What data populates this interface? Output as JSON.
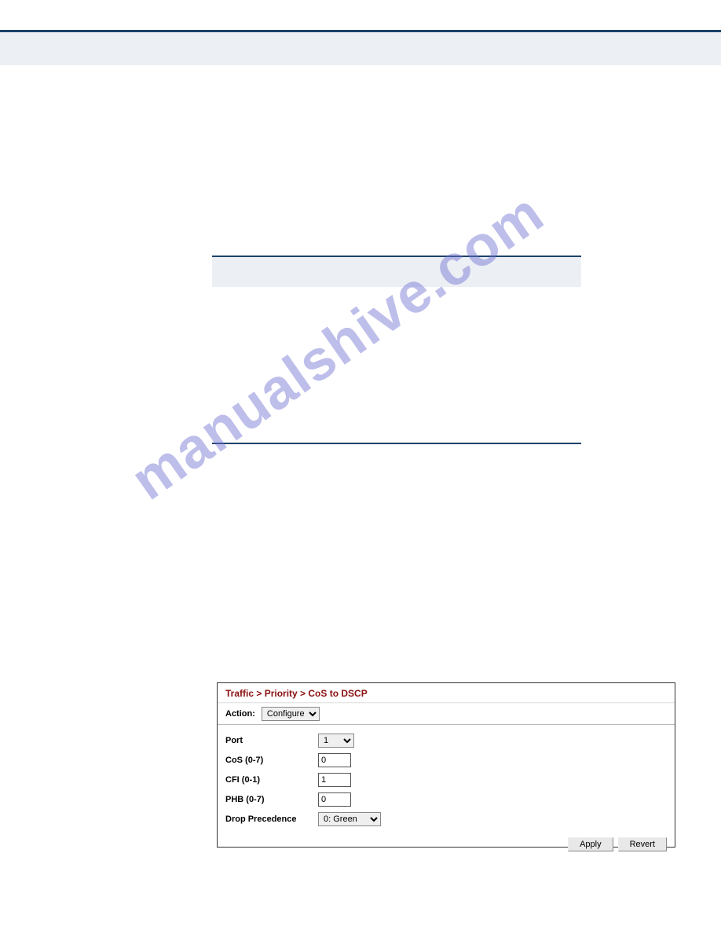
{
  "watermark": "manualshive.com",
  "panel": {
    "title": "Traffic > Priority > CoS to DSCP",
    "action_label": "Action:",
    "action_value": "Configure",
    "fields": {
      "port": {
        "label": "Port",
        "value": "1"
      },
      "cos": {
        "label": "CoS (0-7)",
        "value": "0"
      },
      "cfi": {
        "label": "CFI (0-1)",
        "value": "1"
      },
      "phb": {
        "label": "PHB (0-7)",
        "value": "0"
      },
      "drop": {
        "label": "Drop Precedence",
        "value": "0: Green"
      }
    },
    "buttons": {
      "apply": "Apply",
      "revert": "Revert"
    }
  }
}
